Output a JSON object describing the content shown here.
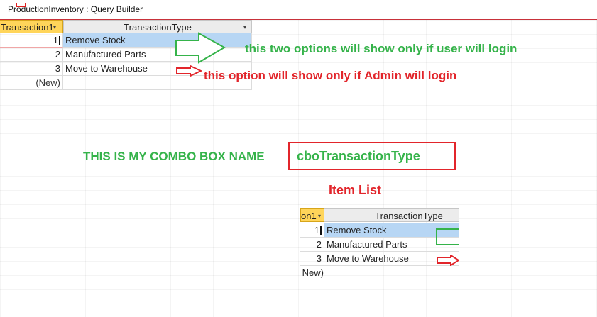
{
  "window": {
    "title": "ProductionInventory : Query Builder"
  },
  "grid_top": {
    "col1_header": "Transaction1",
    "col2_header": "TransactionType",
    "rows": [
      {
        "id": "1",
        "type": "Remove Stock"
      },
      {
        "id": "2",
        "type": "Manufactured Parts"
      },
      {
        "id": "3",
        "type": "Move to Warehouse"
      }
    ],
    "new_row_label": "(New)"
  },
  "grid_bottom": {
    "col1_header": "on1",
    "col2_header": "TransactionType",
    "rows": [
      {
        "id": "1",
        "type": "Remove Stock"
      },
      {
        "id": "2",
        "type": "Manufactured Parts"
      },
      {
        "id": "3",
        "type": "Move to Warehouse"
      }
    ],
    "new_row_label": "New)"
  },
  "annotations": {
    "user_note": "this two options will show only if user will login",
    "admin_note": "this option will show only if Admin will login",
    "combo_label": "THIS IS MY COMBO BOX NAME",
    "combo_name": "cboTransactionType",
    "item_list": "Item List"
  },
  "colors": {
    "green": "#35b34a",
    "red": "#e2252b",
    "header_yellow": "#ffd55a",
    "selection_blue": "#b7d6f4"
  },
  "icons": [
    "dropdown-arrow-icon",
    "green-arrow-icon",
    "red-arrow-icon"
  ]
}
